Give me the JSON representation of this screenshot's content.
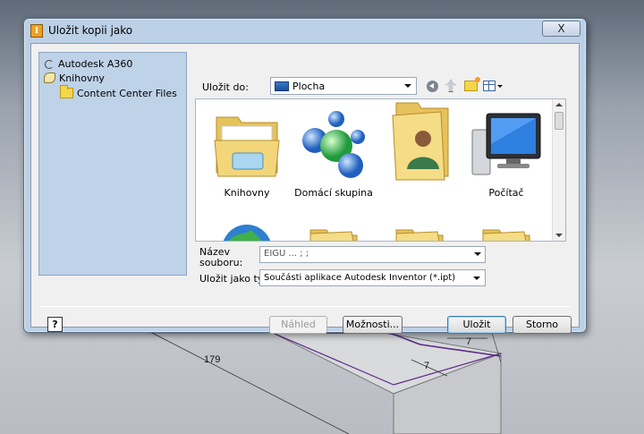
{
  "window": {
    "title": "Uložit kopii jako",
    "close_label": "X"
  },
  "nav": {
    "items": [
      {
        "label": "Autodesk A360",
        "icon": "cloud-icon"
      },
      {
        "label": "Knihovny",
        "icon": "library-icon"
      },
      {
        "label": "Content Center Files",
        "icon": "folder-icon"
      }
    ]
  },
  "save_in": {
    "label": "Uložit do:",
    "value": "Plocha",
    "icon": "desktop-icon"
  },
  "toolbar": {
    "buttons": [
      "back-icon",
      "up-folder-icon",
      "new-folder-icon",
      "view-menu-icon"
    ]
  },
  "files": [
    {
      "label": "Knihovny",
      "icon": "libraries-folder-icon"
    },
    {
      "label": "Domácí skupina",
      "icon": "homegroup-icon"
    },
    {
      "label": "",
      "icon": "user-folder-icon"
    },
    {
      "label": "Počítač",
      "icon": "computer-icon"
    },
    {
      "label": "",
      "icon": "network-globe-icon"
    },
    {
      "label": "",
      "icon": "folder-icon"
    },
    {
      "label": "",
      "icon": "folder-icon"
    },
    {
      "label": "",
      "icon": "folder-icon"
    }
  ],
  "filename": {
    "label": "Název souboru:",
    "value": "EIGU ... ; ;"
  },
  "filetype": {
    "label": "Uložit jako typ:",
    "value": "Součásti aplikace Autodesk Inventor (*.ipt)"
  },
  "buttons": {
    "help": "?",
    "preview": "Náhled",
    "options": "Možnosti...",
    "save": "Uložit",
    "cancel": "Storno"
  },
  "background": {
    "dimension_labels": [
      "179",
      "7",
      "7"
    ]
  }
}
